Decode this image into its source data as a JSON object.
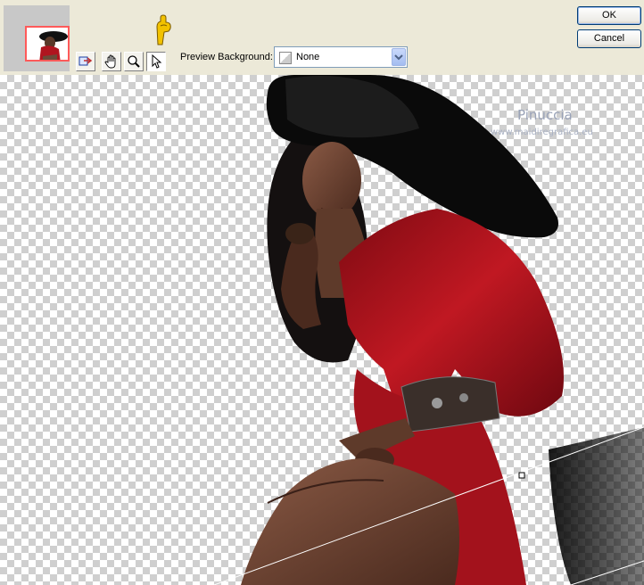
{
  "toolbar": {
    "preview_background_label": "Preview Background:",
    "preview_background_value": "None",
    "tools": [
      "pan-selection-icon",
      "hand-icon",
      "zoom-icon",
      "arrow-select-icon"
    ]
  },
  "buttons": {
    "ok_label": "OK",
    "cancel_label": "Cancel"
  },
  "watermark": {
    "name": "Pinuccia",
    "url": "www.maidiregrafica.eu"
  },
  "colors": {
    "dialog_bg": "#ece9d8",
    "thumbnail_selection": "#ff5a5a",
    "pointer_icon": "#f2c200",
    "select_border": "#7f9db9"
  }
}
